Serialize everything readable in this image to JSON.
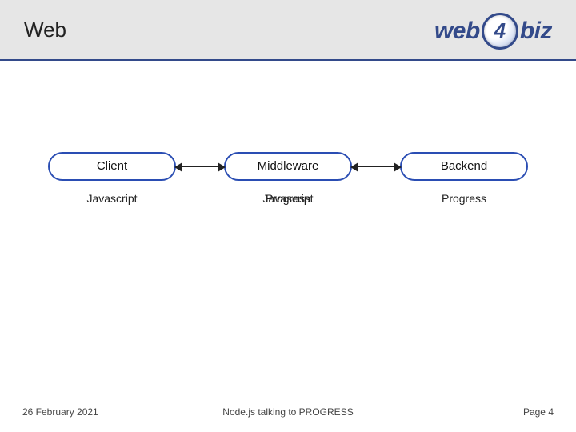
{
  "header": {
    "title": "Web",
    "logo": {
      "word1": "web",
      "globe_digit": "4",
      "word2": "biz"
    }
  },
  "diagram": {
    "boxes": [
      {
        "label": "Client"
      },
      {
        "label": "Middleware"
      },
      {
        "label": "Backend"
      }
    ],
    "tech": [
      {
        "label": "Javascript"
      },
      {
        "under": "Javascript",
        "over": "Progress"
      },
      {
        "label": "Progress"
      }
    ]
  },
  "footer": {
    "date": "26 February 2021",
    "subtitle": "Node.js talking to PROGRESS",
    "page": "Page 4"
  }
}
